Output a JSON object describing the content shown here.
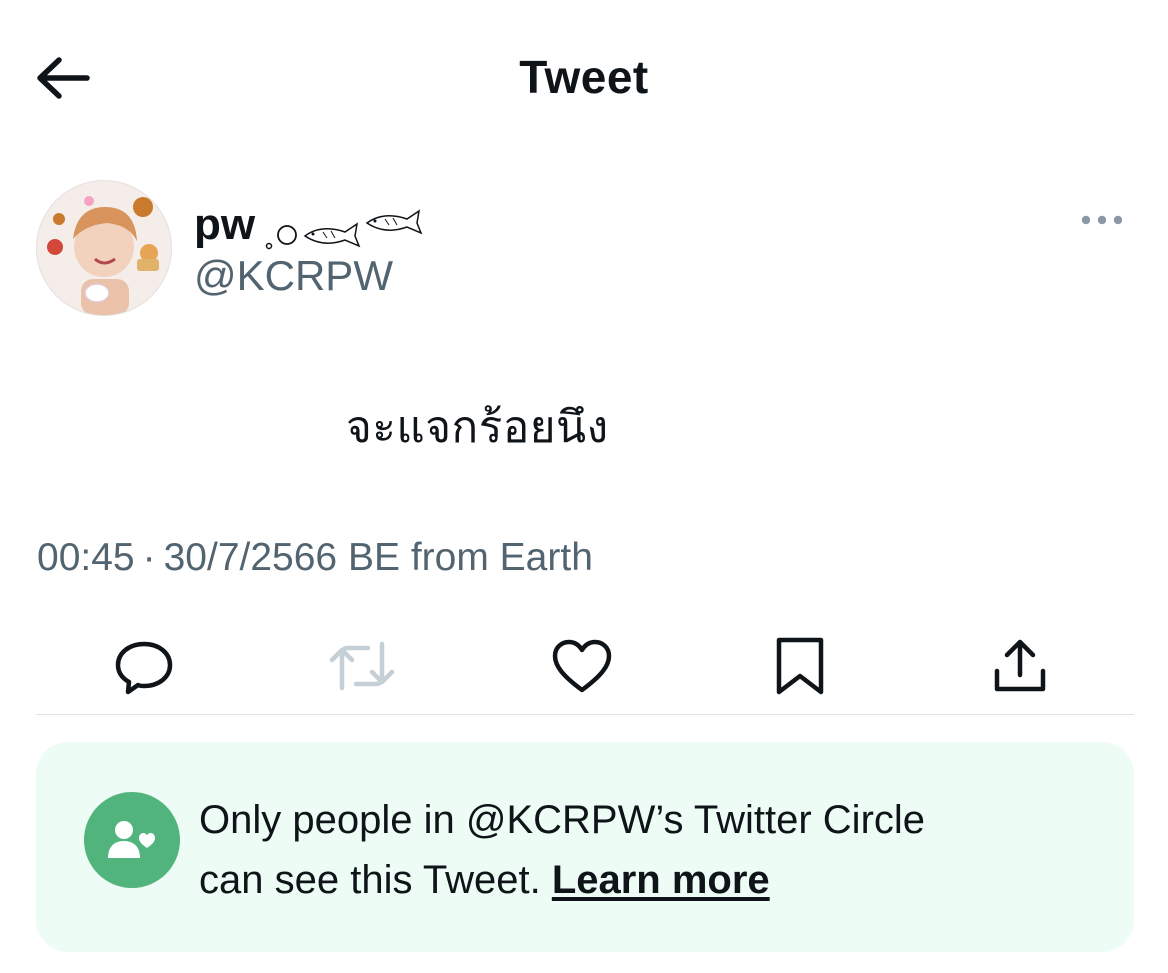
{
  "header": {
    "back_icon": "arrow-left-icon",
    "title": "Tweet"
  },
  "author": {
    "display_name": "pw",
    "name_decoration_icons": [
      "bubble-icon",
      "fish-icon",
      "fish-icon"
    ],
    "handle": "@KCRPW",
    "more_icon": "ellipsis-icon"
  },
  "tweet": {
    "text": "จะแจกร้อยนึง",
    "time": "00:45",
    "separator": "·",
    "date": "30/7/2566 BE",
    "source": "from Earth"
  },
  "actions": {
    "reply_icon": "reply-icon",
    "retweet_icon": "retweet-icon",
    "like_icon": "heart-icon",
    "bookmark_icon": "bookmark-icon",
    "share_icon": "share-icon"
  },
  "circle_notice": {
    "icon": "twitter-circle-icon",
    "line1": "Only people in @KCRPW’s Twitter Circle",
    "line2": "can see this Tweet.",
    "link_label": "Learn more",
    "accent_color": "#52b47d",
    "background_color": "#edfcf5"
  },
  "colors": {
    "text_primary": "#0f1419",
    "text_secondary": "#536471",
    "retweet_disabled": "#c4cfd6"
  }
}
